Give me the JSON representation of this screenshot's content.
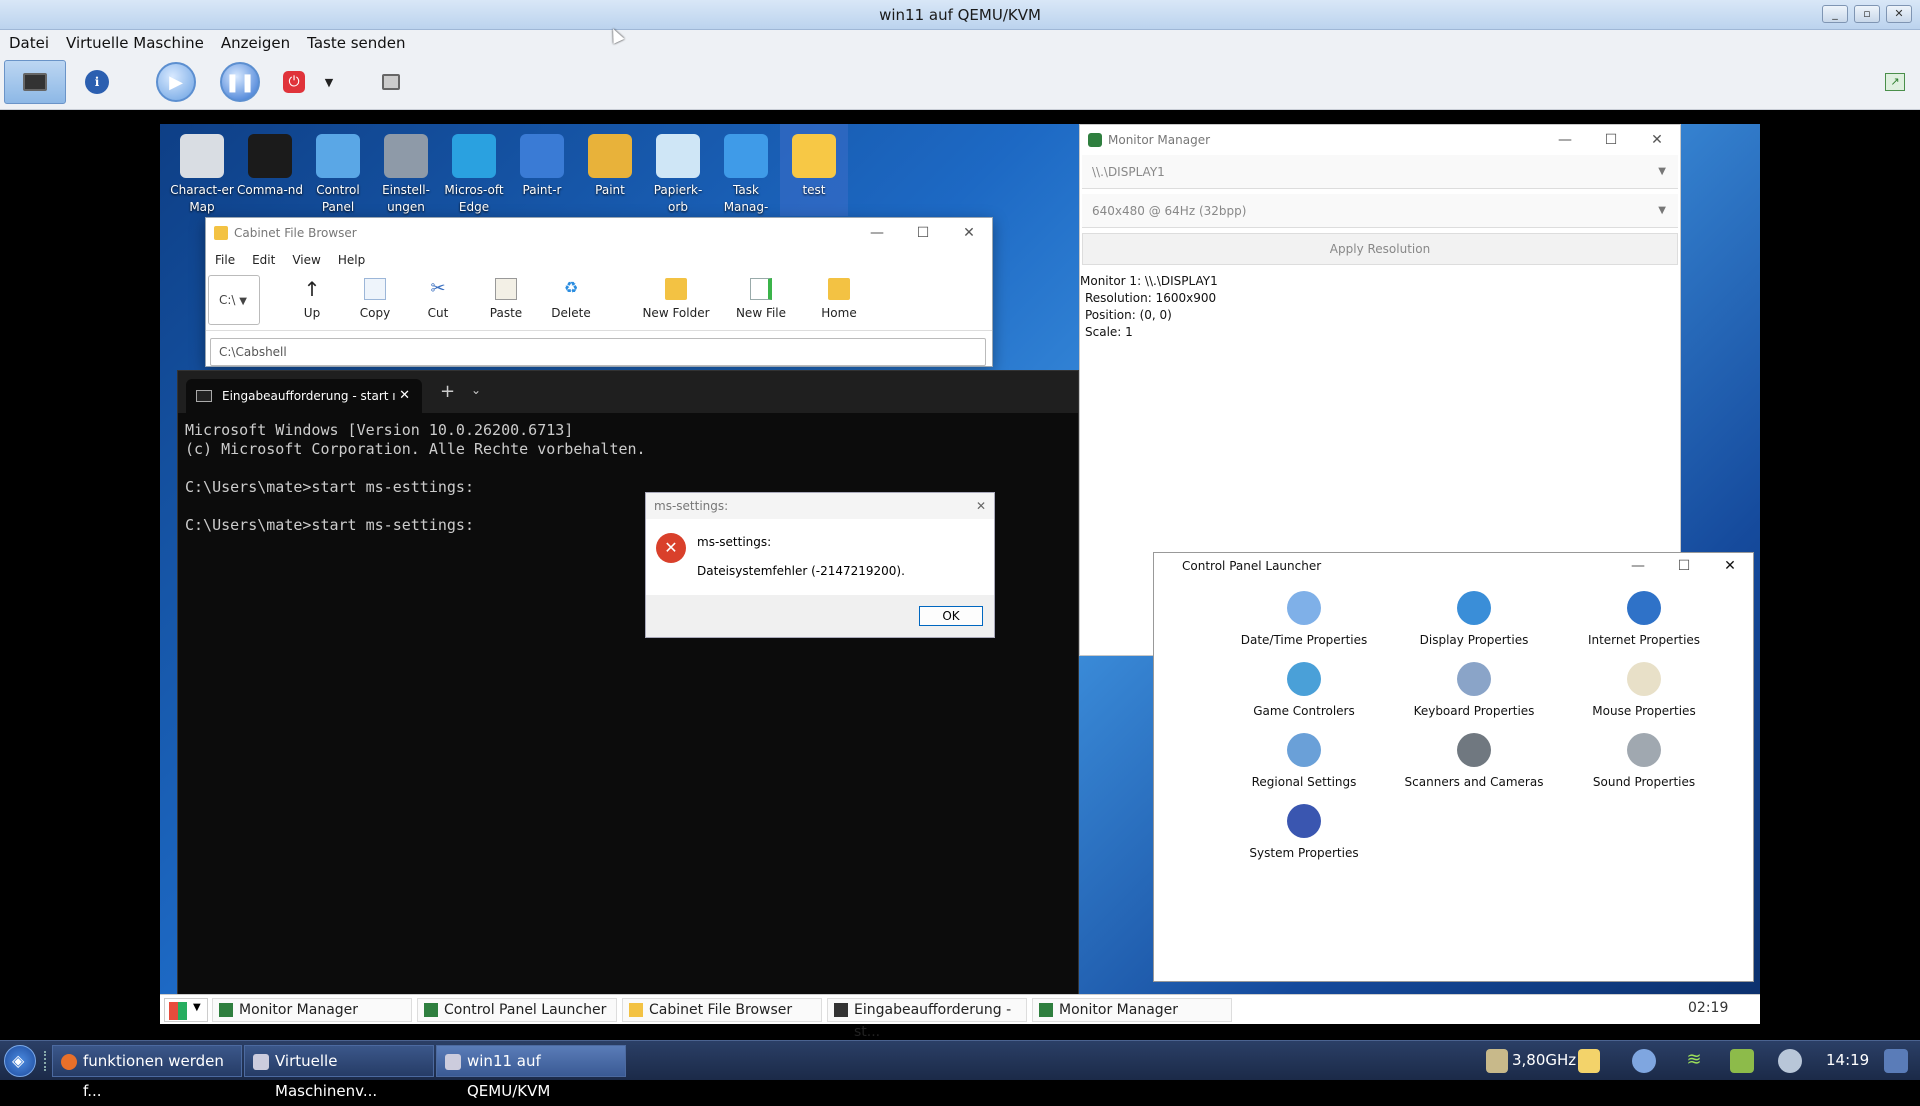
{
  "host": {
    "title": "win11 auf QEMU/KVM",
    "menu": [
      "Datei",
      "Virtuelle Maschine",
      "Anzeigen",
      "Taste senden"
    ],
    "taskbar": {
      "tasks": [
        "funktionen werden f...",
        "Virtuelle Maschinenv...",
        "win11 auf QEMU/KVM"
      ],
      "cpu": "3,80GHz",
      "clock": "14:19"
    }
  },
  "desktop_icons": [
    {
      "label": "Charact-er Map",
      "icon": "character-map-icon",
      "color": "#d9dde3"
    },
    {
      "label": "Comma-nd",
      "icon": "command-prompt-icon",
      "color": "#1b1b1b"
    },
    {
      "label": "Control Panel",
      "icon": "control-panel-icon",
      "color": "#5aa7e6"
    },
    {
      "label": "Einstell-ungen",
      "icon": "settings-gear-icon",
      "color": "#8e9aa8"
    },
    {
      "label": "Micros-oft Edge",
      "icon": "edge-icon",
      "color": "#2aa1e0"
    },
    {
      "label": "Paint-r",
      "icon": "paintr-icon",
      "color": "#3a7bd5"
    },
    {
      "label": "Paint",
      "icon": "paint-palette-icon",
      "color": "#e8b23a"
    },
    {
      "label": "Papierk-orb",
      "icon": "recycle-bin-icon",
      "color": "#cfe6f6"
    },
    {
      "label": "Task Manag-",
      "icon": "task-manager-icon",
      "color": "#3f9be8"
    },
    {
      "label": "test",
      "icon": "folder-icon",
      "color": "#f7c845"
    }
  ],
  "cabinet": {
    "title": "Cabinet File Browser",
    "menu": [
      "File",
      "Edit",
      "View",
      "Help"
    ],
    "drive": "C:\\",
    "buttons": [
      "Up",
      "Copy",
      "Cut",
      "Paste",
      "Delete",
      "New Folder",
      "New File",
      "Home"
    ],
    "path": "C:\\Cabshell"
  },
  "terminal": {
    "tab": "Eingabeaufforderung - start ı",
    "lines": [
      "Microsoft Windows [Version 10.0.26200.6713]",
      "(c) Microsoft Corporation. Alle Rechte vorbehalten.",
      "",
      "C:\\Users\\mate>start ms-esttings:",
      "",
      "C:\\Users\\mate>start ms-settings:"
    ]
  },
  "dialog": {
    "title": "ms-settings:",
    "heading": "ms-settings:",
    "message": "Dateisystemfehler (-2147219200).",
    "ok": "OK"
  },
  "monitor_manager": {
    "title": "Monitor Manager",
    "display_select": "\\\\.\\DISPLAY1",
    "mode_select": "640x480 @ 64Hz (32bpp)",
    "apply": "Apply Resolution",
    "info": [
      "Monitor 1: \\\\.\\DISPLAY1",
      "Resolution: 1600x900",
      "Position: (0, 0)",
      "Scale: 1"
    ]
  },
  "cpl": {
    "title": "Control Panel Launcher",
    "items": [
      "Date/Time Properties",
      "Display Properties",
      "Internet Properties",
      "Game Controlers",
      "Keyboard Properties",
      "Mouse Properties",
      "Regional Settings",
      "Scanners and Cameras",
      "Sound Properties",
      "System Properties"
    ]
  },
  "guest_taskbar": {
    "tasks": [
      "Monitor Manager",
      "Control Panel Launcher",
      "Cabinet File Browser",
      "Eingabeaufforderung - st...",
      "Monitor Manager"
    ],
    "clock": "02:19"
  }
}
